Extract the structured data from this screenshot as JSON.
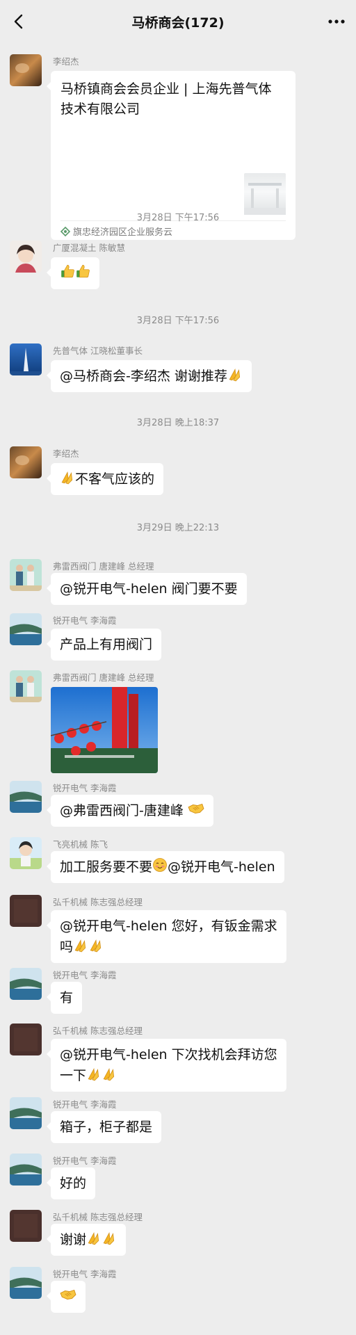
{
  "header": {
    "title": "马桥商会(172)"
  },
  "timestamps": [
    "3月28日 下午17:56",
    "3月28日 下午17:56",
    "3月28日 晚上18:37",
    "3月29日 晚上22:13"
  ],
  "messages": [
    {
      "sender": "李绍杰",
      "card_title": "马桥镇商会会员企业 | 上海先普气体技术有限公司",
      "card_source": "旗忠经济园区企业服务云"
    },
    {
      "sender": "广厦混凝土 陈敏慧",
      "text": ""
    },
    {
      "sender": "先普气体 江晓松董事长",
      "text": "@马桥商会-李绍杰  谢谢推荐"
    },
    {
      "sender": "李绍杰",
      "text": "不客气应该的"
    },
    {
      "sender": "弗雷西阀门 唐建峰 总经理",
      "text": "@锐开电气-helen 阀门要不要"
    },
    {
      "sender": "锐开电气  李海霞",
      "text": "产品上有用阀门"
    },
    {
      "sender": "弗雷西阀门 唐建峰 总经理"
    },
    {
      "sender": "锐开电气  李海霞",
      "text": "@弗雷西阀门-唐建峰 "
    },
    {
      "sender": "飞亮机械 陈飞",
      "text_a": "加工服务要不要",
      "text_b": "@锐开电气-helen"
    },
    {
      "sender": "弘千机械 陈志强总经理",
      "line1": "@锐开电气-helen 您好，有钣金需求",
      "line2": "吗"
    },
    {
      "sender": "锐开电气  李海霞",
      "text": "有"
    },
    {
      "sender": "弘千机械 陈志强总经理",
      "line1": "@锐开电气-helen 下次找机会拜访您",
      "line2": "一下"
    },
    {
      "sender": "锐开电气  李海霞",
      "text": "箱子，柜子都是"
    },
    {
      "sender": "锐开电气  李海霞",
      "text": "好的"
    },
    {
      "sender": "弘千机械 陈志强总经理",
      "text": "谢谢"
    },
    {
      "sender": "锐开电气  李海霞",
      "text": ""
    }
  ],
  "colors": {
    "background": "#ededed",
    "bubble": "#ffffff",
    "meta_text": "#8a8a8a"
  },
  "icons": [
    "back-arrow-icon",
    "more-icon",
    "thumbs-up-icon",
    "folded-hands-icon",
    "handshake-icon",
    "blush-face-icon",
    "service-cloud-icon"
  ]
}
